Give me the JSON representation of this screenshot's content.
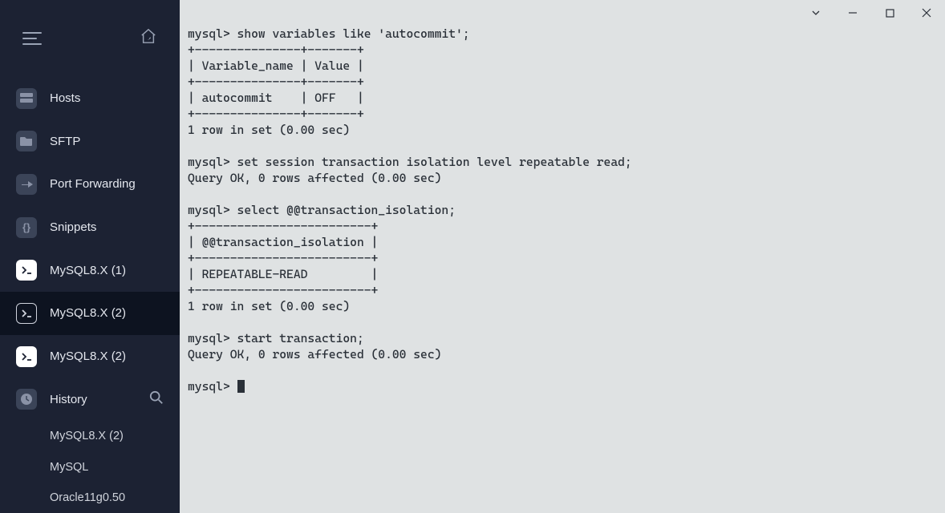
{
  "sidebar": {
    "items": [
      {
        "label": "Hosts"
      },
      {
        "label": "SFTP"
      },
      {
        "label": "Port Forwarding"
      },
      {
        "label": "Snippets"
      },
      {
        "label": "MySQL8.X (1)"
      },
      {
        "label": "MySQL8.X (2)"
      },
      {
        "label": "MySQL8.X (2)"
      },
      {
        "label": "History"
      }
    ],
    "history": [
      {
        "label": "MySQL8.X (2)"
      },
      {
        "label": "MySQL"
      },
      {
        "label": "Oracle11g0.50"
      }
    ]
  },
  "terminal": {
    "lines": [
      "mysql> show variables like 'autocommit';",
      "+---------------+-------+",
      "| Variable_name | Value |",
      "+---------------+-------+",
      "| autocommit    | OFF   |",
      "+---------------+-------+",
      "1 row in set (0.00 sec)",
      "",
      "mysql> set session transaction isolation level repeatable read;",
      "Query OK, 0 rows affected (0.00 sec)",
      "",
      "mysql> select @@transaction_isolation;",
      "+-------------------------+",
      "| @@transaction_isolation |",
      "+-------------------------+",
      "| REPEATABLE-READ         |",
      "+-------------------------+",
      "1 row in set (0.00 sec)",
      "",
      "mysql> start transaction;",
      "Query OK, 0 rows affected (0.00 sec)",
      "",
      "mysql> "
    ]
  }
}
